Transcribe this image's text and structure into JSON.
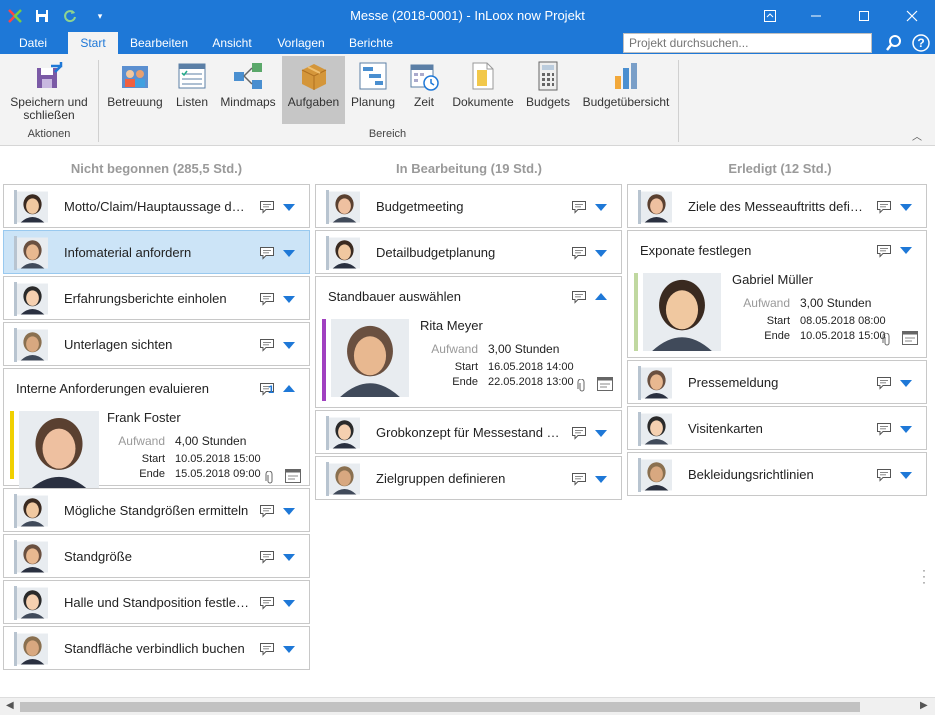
{
  "window": {
    "title": "Messe (2018-0001) - InLoox now Projekt"
  },
  "menu": {
    "tabs": [
      "Datei",
      "Start",
      "Bearbeiten",
      "Ansicht",
      "Vorlagen",
      "Berichte"
    ],
    "active": "Start"
  },
  "search": {
    "placeholder": "Projekt durchsuchen..."
  },
  "ribbon": {
    "buttons": {
      "save": "Speichern und schließen",
      "betreuung": "Betreuung",
      "listen": "Listen",
      "mindmaps": "Mindmaps",
      "aufgaben": "Aufgaben",
      "planung": "Planung",
      "zeit": "Zeit",
      "dokumente": "Dokumente",
      "budgets": "Budgets",
      "budgetuebersicht": "Budgetübersicht"
    },
    "groups": {
      "aktionen": "Aktionen",
      "bereich": "Bereich"
    }
  },
  "board": {
    "columns": [
      {
        "header": "Nicht begonnen (285,5 Std.)",
        "cards": [
          {
            "title": "Motto/Claim/Hauptaussage def..."
          },
          {
            "title": "Infomaterial anfordern",
            "selected": true
          },
          {
            "title": "Erfahrungsberichte einholen"
          },
          {
            "title": "Unterlagen sichten"
          },
          {
            "title": "Interne Anforderungen evaluieren",
            "expanded": true,
            "comments": "1",
            "person": "Frank Foster",
            "effort_label": "Aufwand",
            "effort": "4,00 Stunden",
            "start_label": "Start",
            "start": "10.05.2018 15:00",
            "end_label": "Ende",
            "end": "15.05.2018 09:00",
            "bar_color": "#f0d000"
          },
          {
            "title": "Mögliche Standgrößen ermitteln"
          },
          {
            "title": "Standgröße"
          },
          {
            "title": "Halle und Standposition festleg..."
          },
          {
            "title": "Standfläche verbindlich buchen"
          }
        ]
      },
      {
        "header": "In Bearbeitung (19 Std.)",
        "cards": [
          {
            "title": "Budgetmeeting"
          },
          {
            "title": "Detailbudgetplanung"
          },
          {
            "title": "Standbauer auswählen",
            "expanded": true,
            "person": "Rita Meyer",
            "effort_label": "Aufwand",
            "effort": "3,00 Stunden",
            "start_label": "Start",
            "start": "16.05.2018 14:00",
            "end_label": "Ende",
            "end": "22.05.2018 13:00",
            "bar_color": "#a040c0"
          },
          {
            "title": "Grobkonzept für Messestand e..."
          },
          {
            "title": "Zielgruppen definieren"
          }
        ]
      },
      {
        "header": "Erledigt (12 Std.)",
        "cards": [
          {
            "title": "Ziele des Messeauftritts definie..."
          },
          {
            "title": "Exponate festlegen",
            "expanded": true,
            "person": "Gabriel Müller",
            "effort_label": "Aufwand",
            "effort": "3,00 Stunden",
            "start_label": "Start",
            "start": "08.05.2018 08:00",
            "end_label": "Ende",
            "end": "10.05.2018 15:00",
            "bar_color": "#c0d8a0"
          },
          {
            "title": "Pressemeldung"
          },
          {
            "title": "Visitenkarten"
          },
          {
            "title": "Bekleidungsrichtlinien"
          }
        ]
      }
    ]
  },
  "colors": {
    "accent": "#1e78d7",
    "ribbon_bg": "#f3f3f3",
    "selected_card": "#cce4f7"
  }
}
